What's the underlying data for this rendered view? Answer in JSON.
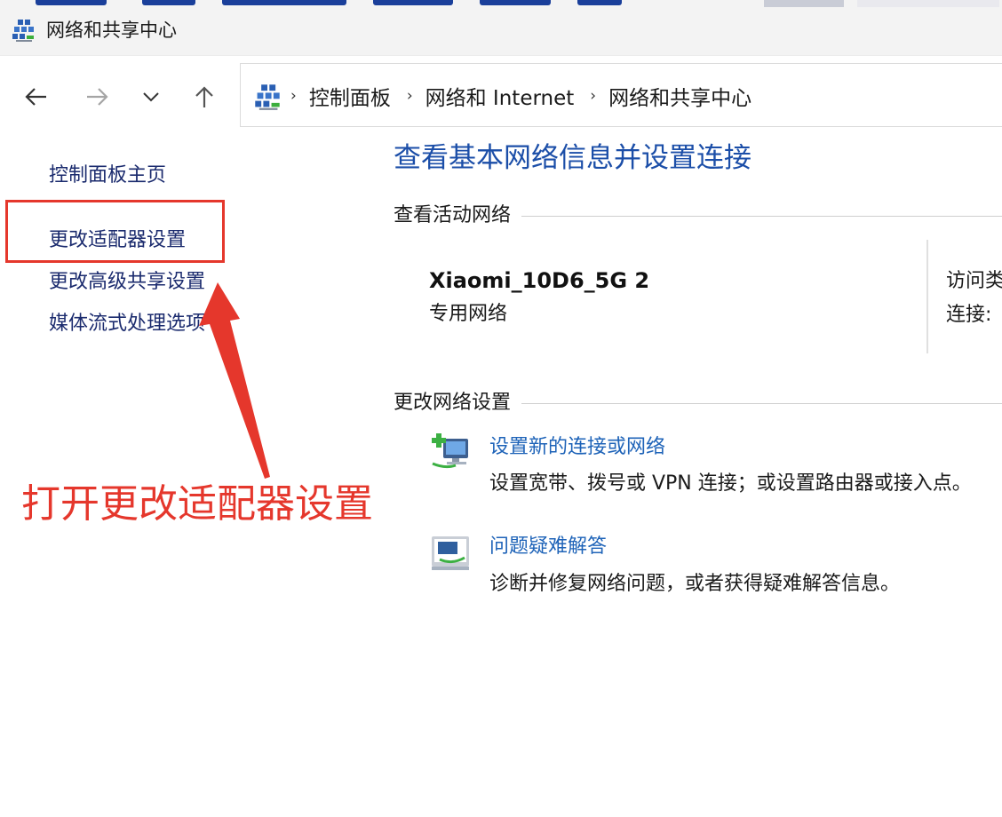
{
  "window": {
    "title": "网络和共享中心",
    "title_icon": "network-sharing-center-icon"
  },
  "nav": {
    "back_icon": "arrow-left-icon",
    "forward_icon": "arrow-right-icon",
    "recent_icon": "chevron-down-icon",
    "up_icon": "arrow-up-icon"
  },
  "address": {
    "icon": "network-sharing-center-icon",
    "crumbs": [
      "控制面板",
      "网络和 Internet",
      "网络和共享中心"
    ]
  },
  "left_pane": {
    "links": [
      "控制面板主页",
      "更改适配器设置",
      "更改高级共享设置",
      "媒体流式处理选项"
    ]
  },
  "annotation": {
    "text": "打开更改适配器设置",
    "color": "#e5372c"
  },
  "main": {
    "title": "查看基本网络信息并设置连接",
    "active_networks_heading": "查看活动网络",
    "network": {
      "name": "Xiaomi_10D6_5G 2",
      "type": "专用网络",
      "access_type_label": "访问类",
      "connections_label": "连接:"
    },
    "change_settings_heading": "更改网络设置",
    "tasks": [
      {
        "icon": "new-connection-icon",
        "link": "设置新的连接或网络",
        "desc": "设置宽带、拨号或 VPN 连接；或设置路由器或接入点。"
      },
      {
        "icon": "troubleshoot-icon",
        "link": "问题疑难解答",
        "desc": "诊断并修复网络问题，或者获得疑难解答信息。"
      }
    ]
  },
  "colors": {
    "link_dark": "#1b2b6e",
    "link_blue": "#1e63b8",
    "title_blue": "#1b4ea8",
    "annotation_red": "#e5372c"
  }
}
